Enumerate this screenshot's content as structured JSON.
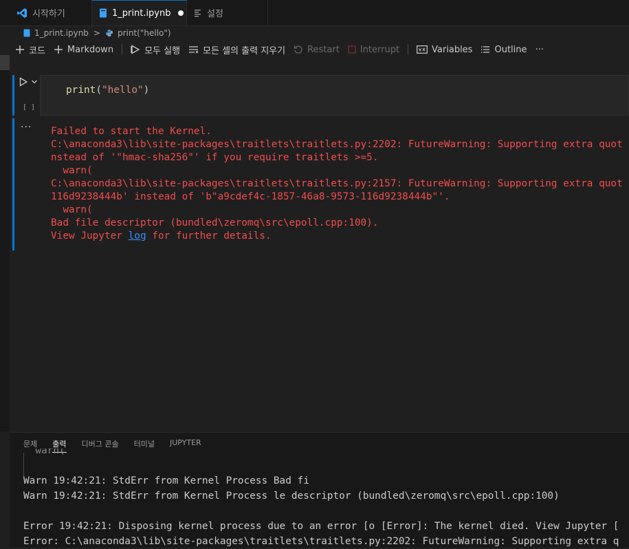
{
  "tabs": [
    {
      "label": "시작하기",
      "icon": "vscode-logo-icon"
    },
    {
      "label": "1_print.ipynb",
      "icon": "notebook-icon",
      "dirty": true
    },
    {
      "label": "설정",
      "icon": "settings-editor-icon"
    }
  ],
  "breadcrumb": {
    "file": "1_print.ipynb",
    "symbol": "print(\"hello\")"
  },
  "toolbar": {
    "add_code": "코드",
    "add_markdown": "Markdown",
    "run_all": "모두 실행",
    "clear_outputs": "모든 셀의 출력 지우기",
    "restart": "Restart",
    "interrupt": "Interrupt",
    "variables": "Variables",
    "outline": "Outline",
    "more": "···"
  },
  "cell": {
    "exec_count": "[ ]",
    "code_fn": "print",
    "code_open": "(",
    "code_str": "\"hello\"",
    "code_close": ")"
  },
  "output": {
    "more": "···",
    "lines": [
      "Failed to start the Kernel.",
      "C:\\anaconda3\\lib\\site-packages\\traitlets\\traitlets.py:2202: FutureWarning: Supporting extra quot",
      "nstead of '\"hmac-sha256\"' if you require traitlets >=5.",
      "  warn(",
      "C:\\anaconda3\\lib\\site-packages\\traitlets\\traitlets.py:2157: FutureWarning: Supporting extra quot",
      "116d9238444b' instead of 'b\"a9cdef4c-1857-46a8-9573-116d9238444b\"'.",
      "  warn(",
      "Bad file descriptor (bundled\\zeromq\\src\\epoll.cpp:100)."
    ],
    "last_prefix": "View Jupyter ",
    "last_link": "log",
    "last_suffix": " for further details."
  },
  "panel": {
    "tabs": [
      "문제",
      "출력",
      "디버그 콘솔",
      "터미널",
      "JUPYTER"
    ],
    "active_tab": "출력",
    "log": [
      "  warn(",
      "",
      "Warn 19:42:21: StdErr from Kernel Process Bad fi",
      "Warn 19:42:21: StdErr from Kernel Process le descriptor (bundled\\zeromq\\src\\epoll.cpp:100)",
      "",
      "Error 19:42:21: Disposing kernel process due to an error [o [Error]: The kernel died. View Jupyter [",
      "Error: C:\\anaconda3\\lib\\site-packages\\traitlets\\traitlets.py:2202: FutureWarning: Supporting extra q"
    ]
  },
  "colors": {
    "accent": "#0078d4",
    "error": "#f14c4c",
    "link": "#3794ff"
  }
}
